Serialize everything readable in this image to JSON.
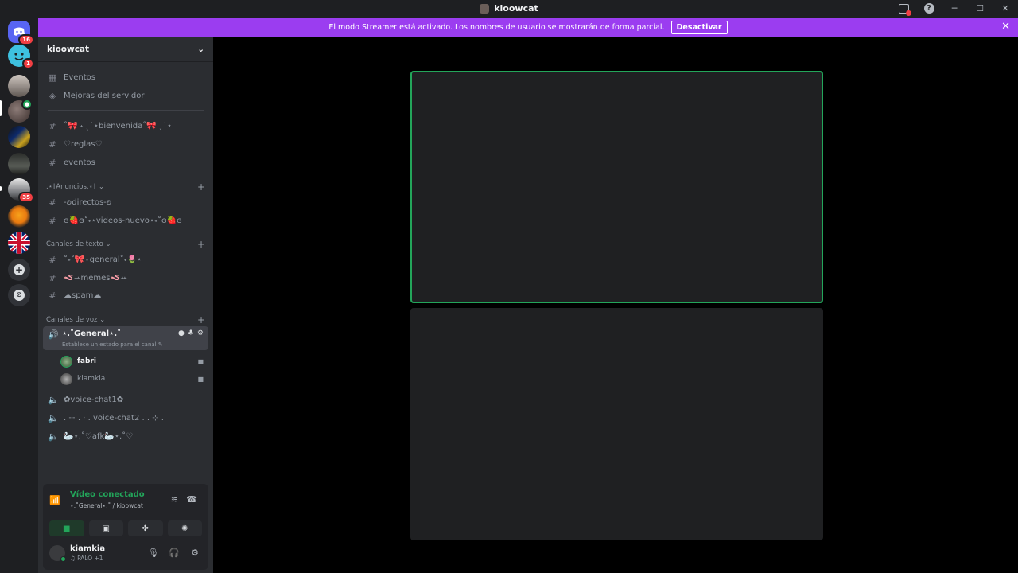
{
  "window": {
    "title": "kioowcat",
    "help_label": "?",
    "minimize_label": "─",
    "maximize_label": "☐",
    "close_label": "✕"
  },
  "banner": {
    "message": "El modo Streamer está activado. Los nombres de usuario se mostrarán de forma parcial.",
    "button_label": "Desactivar",
    "close_label": "✕"
  },
  "guilds": [
    {
      "name": "direct-messages",
      "badge": "16"
    },
    {
      "name": "guild-2",
      "badge": "1"
    },
    {
      "name": "guild-3",
      "badge": ""
    },
    {
      "name": "guild-4",
      "badge": ""
    },
    {
      "name": "guild-5",
      "badge": ""
    },
    {
      "name": "guild-6",
      "badge": ""
    },
    {
      "name": "guild-7",
      "badge": "35"
    },
    {
      "name": "guild-8",
      "badge": ""
    },
    {
      "name": "guild-9",
      "badge": ""
    }
  ],
  "guild_actions": {
    "add": "+",
    "explore": "⊘"
  },
  "server": {
    "name": "kioowcat",
    "chevron": "⌄",
    "events": "Eventos",
    "boosts": "Mejoras del servidor",
    "top_channels": [
      "˚🎀 ˖ ˎ˙⋆bienvenida˚🎀 ˎ˙⋆",
      "♡reglas♡",
      "eventos"
    ],
    "announcements": {
      "title": ".⋆†Anuncios.⋆† ⌄",
      "channels": [
        "-ʚdirectos-ʚ",
        "ɞ🍓ɞ˚˖⋆videos-nuevo⋆˖˚ɞ🍓ɞ"
      ]
    },
    "text_category": {
      "title": "Canales de texto ⌄",
      "channels": [
        "˚˖˚🎀⋆general˚˖🌷⋆",
        "🪱ꕀmemes🪱ꕀ",
        "☁spam☁"
      ]
    },
    "voice_category": {
      "title": "Canales de voz ⌄",
      "active_channel": "⋆.˚General⋆.˚",
      "active_status": "Establece un estado para el canal ✎",
      "members": [
        {
          "name": "fabri",
          "color": "#5a7a4f"
        },
        {
          "name": "kiamkia",
          "color": "#555"
        }
      ],
      "channels": [
        "✿voice-chat1✿",
        ". ⊹ . ⋅ . voice-chat2 . . ⊹ .",
        "🦢⋆.˚♡afk🦢⋆.˚♡"
      ]
    },
    "add_label": "+"
  },
  "voice_panel": {
    "status": "Vídeo conectado",
    "location": "⋆.˚General⋆.˚ / kioowcat",
    "buttons": [
      "camera",
      "screen-share",
      "activities",
      "soundboard"
    ]
  },
  "user": {
    "name": "kiamkia",
    "status": "♫ PALO +1"
  },
  "colors": {
    "banner": "#9b3df0",
    "speaking": "#23a55a",
    "connected": "#23a55a",
    "badge": "#f23f43"
  }
}
